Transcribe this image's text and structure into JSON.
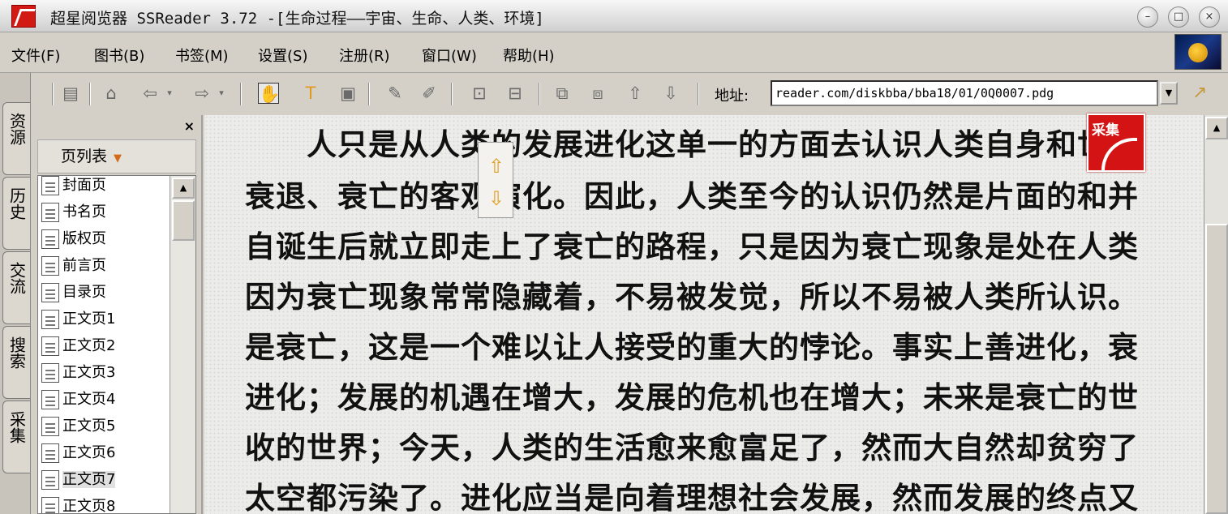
{
  "window": {
    "title": "超星阅览器 SSReader 3.72 -[生命过程——宇宙、生命、人类、环境]",
    "minimize": "–",
    "maximize": "□",
    "close": "×"
  },
  "menu": [
    {
      "label": "文件(F)"
    },
    {
      "label": "图书(B)"
    },
    {
      "label": "书签(M)"
    },
    {
      "label": "设置(S)"
    },
    {
      "label": "注册(R)"
    },
    {
      "label": "窗口(W)"
    },
    {
      "label": "帮助(H)"
    }
  ],
  "side_tabs": [
    "资源",
    "历史",
    "交流",
    "搜索",
    "采集"
  ],
  "toolbar": {
    "icons": [
      "toc-icon",
      "home-icon",
      "back-icon",
      "forward-icon",
      "hand-icon",
      "text-select-icon",
      "image-select-icon",
      "bookmark-icon",
      "annotate-icon",
      "fit-width-icon",
      "fit-page-icon",
      "prev-chapter-icon",
      "next-chapter-icon",
      "prev-page-icon",
      "next-page-icon"
    ],
    "address_label": "地址:",
    "address_value": "reader.com/diskbba/bba18/01/0Q0007.pdg"
  },
  "side_panel": {
    "close": "×",
    "header": "页列表",
    "pages": [
      "封面页",
      "书名页",
      "版权页",
      "前言页",
      "目录页",
      "正文页1",
      "正文页2",
      "正文页3",
      "正文页4",
      "正文页5",
      "正文页6",
      "正文页7",
      "正文页8"
    ],
    "selected_index": 11
  },
  "stamp_text": "采集",
  "document": {
    "lines": [
      "　　人只是从人类的发展进化这单一的方面去认识人类自身和世界",
      "衰退、衰亡的客观演化。因此，人类至今的认识仍然是片面的和并",
      "自诞生后就立即走上了衰亡的路程，只是因为衰亡现象是处在人类",
      "因为衰亡现象常常隐藏着，不易被发觉，所以不易被人类所认识。",
      "是衰亡，这是一个难以让人接受的重大的悖论。事实上善进化，衰",
      "进化；发展的机遇在增大，发展的危机也在增大；未来是衰亡的世",
      "收的世界；今天，人类的生活愈来愈富足了，然而大自然却贫穷了",
      "太空都污染了。进化应当是向着理想社会发展，然而发展的终点又"
    ]
  }
}
